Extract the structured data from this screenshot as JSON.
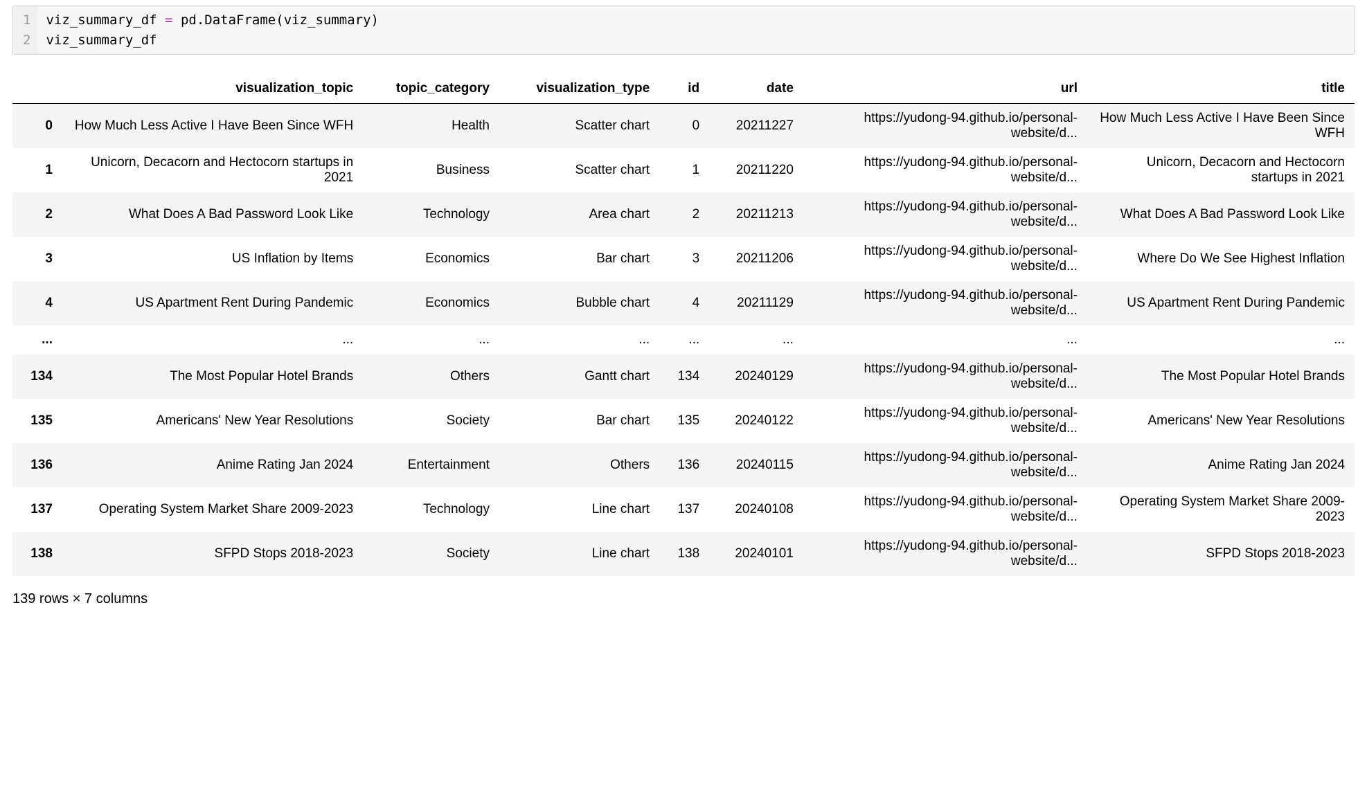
{
  "code": {
    "gutter": [
      "1",
      "2"
    ],
    "line1_var": "viz_summary_df",
    "line1_eq": " = ",
    "line1_mod": "pd",
    "line1_dot": ".",
    "line1_func": "DataFrame",
    "line1_open": "(",
    "line1_arg": "viz_summary",
    "line1_close": ")",
    "line2": "viz_summary_df"
  },
  "table": {
    "columns": [
      "visualization_topic",
      "topic_category",
      "visualization_type",
      "id",
      "date",
      "url",
      "title"
    ],
    "rows": [
      {
        "idx": "0",
        "visualization_topic": "How Much Less Active I Have Been Since WFH",
        "topic_category": "Health",
        "visualization_type": "Scatter chart",
        "id": "0",
        "date": "20211227",
        "url": "https://yudong-94.github.io/personal-website/d...",
        "title": "How Much Less Active I Have Been Since WFH"
      },
      {
        "idx": "1",
        "visualization_topic": "Unicorn, Decacorn and Hectocorn startups in 2021",
        "topic_category": "Business",
        "visualization_type": "Scatter chart",
        "id": "1",
        "date": "20211220",
        "url": "https://yudong-94.github.io/personal-website/d...",
        "title": "Unicorn, Decacorn and Hectocorn startups in 2021"
      },
      {
        "idx": "2",
        "visualization_topic": "What Does A Bad Password Look Like",
        "topic_category": "Technology",
        "visualization_type": "Area chart",
        "id": "2",
        "date": "20211213",
        "url": "https://yudong-94.github.io/personal-website/d...",
        "title": "What Does A Bad Password Look Like"
      },
      {
        "idx": "3",
        "visualization_topic": "US Inflation by Items",
        "topic_category": "Economics",
        "visualization_type": "Bar chart",
        "id": "3",
        "date": "20211206",
        "url": "https://yudong-94.github.io/personal-website/d...",
        "title": "Where Do We See Highest Inflation"
      },
      {
        "idx": "4",
        "visualization_topic": "US Apartment Rent During Pandemic",
        "topic_category": "Economics",
        "visualization_type": "Bubble chart",
        "id": "4",
        "date": "20211129",
        "url": "https://yudong-94.github.io/personal-website/d...",
        "title": "US Apartment Rent During Pandemic"
      },
      {
        "idx": "...",
        "visualization_topic": "...",
        "topic_category": "...",
        "visualization_type": "...",
        "id": "...",
        "date": "...",
        "url": "...",
        "title": "..."
      },
      {
        "idx": "134",
        "visualization_topic": "The Most Popular Hotel Brands",
        "topic_category": "Others",
        "visualization_type": "Gantt chart",
        "id": "134",
        "date": "20240129",
        "url": "https://yudong-94.github.io/personal-website/d...",
        "title": "The Most Popular Hotel Brands"
      },
      {
        "idx": "135",
        "visualization_topic": "Americans' New Year Resolutions",
        "topic_category": "Society",
        "visualization_type": "Bar chart",
        "id": "135",
        "date": "20240122",
        "url": "https://yudong-94.github.io/personal-website/d...",
        "title": "Americans' New Year Resolutions"
      },
      {
        "idx": "136",
        "visualization_topic": "Anime Rating Jan 2024",
        "topic_category": "Entertainment",
        "visualization_type": "Others",
        "id": "136",
        "date": "20240115",
        "url": "https://yudong-94.github.io/personal-website/d...",
        "title": "Anime Rating Jan 2024"
      },
      {
        "idx": "137",
        "visualization_topic": "Operating System Market Share 2009-2023",
        "topic_category": "Technology",
        "visualization_type": "Line chart",
        "id": "137",
        "date": "20240108",
        "url": "https://yudong-94.github.io/personal-website/d...",
        "title": "Operating System Market Share 2009-2023"
      },
      {
        "idx": "138",
        "visualization_topic": "SFPD Stops 2018-2023",
        "topic_category": "Society",
        "visualization_type": "Line chart",
        "id": "138",
        "date": "20240101",
        "url": "https://yudong-94.github.io/personal-website/d...",
        "title": "SFPD Stops 2018-2023"
      }
    ]
  },
  "summary": "139 rows × 7 columns"
}
